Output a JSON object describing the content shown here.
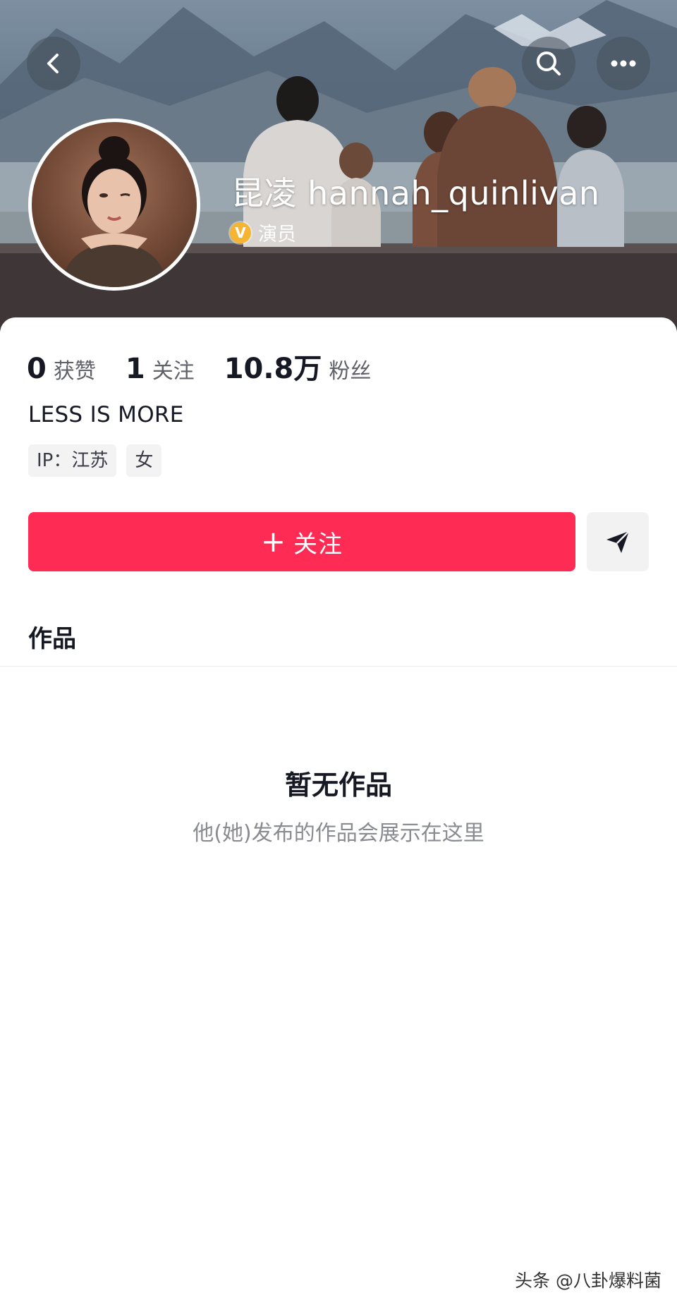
{
  "header": {
    "back_icon": "chevron-left-icon",
    "search_icon": "search-icon",
    "more_icon": "more-horizontal-icon"
  },
  "profile": {
    "display_name": "昆凌 hannah_quinlivan",
    "verified_badge": "V",
    "verification_label": "演员",
    "stats": [
      {
        "value": "0",
        "label": "获赞"
      },
      {
        "value": "1",
        "label": "关注"
      },
      {
        "value": "10.8万",
        "label": "粉丝"
      }
    ],
    "bio": "LESS IS MORE",
    "tags": [
      "IP：江苏",
      "女"
    ]
  },
  "actions": {
    "follow_plus": "+",
    "follow_label": "关注",
    "share_icon": "send-arrow-icon"
  },
  "tabs": {
    "works_label": "作品"
  },
  "empty_state": {
    "title": "暂无作品",
    "subtitle": "他(她)发布的作品会展示在这里"
  },
  "watermark": "头条 @八卦爆料菌",
  "colors": {
    "accent": "#fe2c55",
    "verified": "#f6b530",
    "text_primary": "#161823",
    "text_secondary": "#8a8b91"
  }
}
